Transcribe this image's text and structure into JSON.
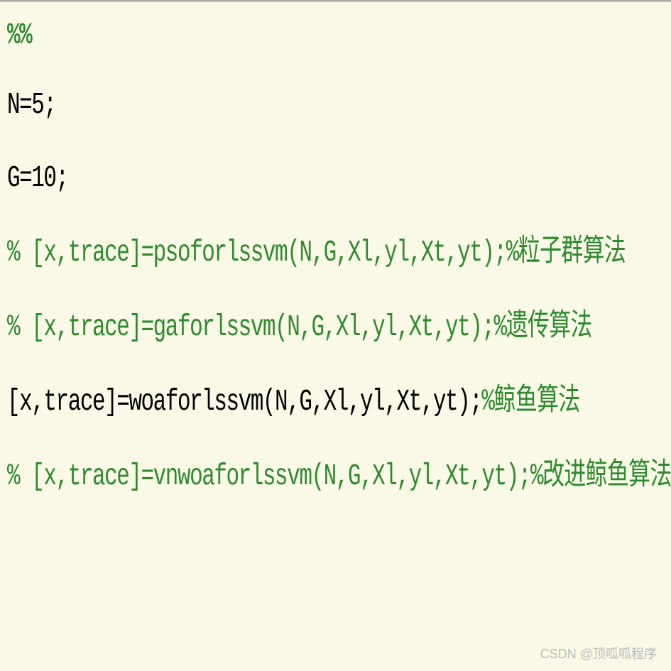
{
  "code": {
    "line1": "%%",
    "line2": "N=5;",
    "line3": "G=10;",
    "line4_a": "% [x,trace]=psoforlssvm(N,G,Xl,yl,Xt,yt);%",
    "line4_b": "粒子群算法",
    "line5_a": "% [x,trace]=gaforlssvm(N,G,Xl,yl,Xt,yt);%",
    "line5_b": "遗传算法",
    "line6_a": "[x,trace]=woaforlssvm(N,G,Xl,yl,Xt,yt);",
    "line6_b": "%",
    "line6_c": "鲸鱼算法",
    "line7_a": "% [x,trace]=vnwoaforlssvm(N,G,Xl,yl,Xt,yt);%",
    "line7_b": "改进鲸鱼算法"
  },
  "watermark": "CSDN @顶呱呱程序"
}
